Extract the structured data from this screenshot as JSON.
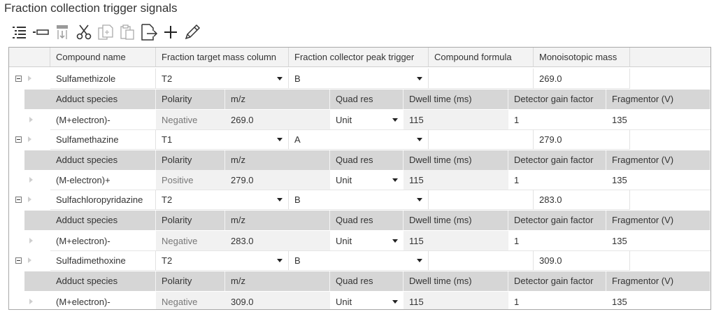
{
  "title": "Fraction collection trigger signals",
  "toolbar": {
    "icons": [
      "list-icon",
      "collapse-icon",
      "insert-below-icon",
      "cut-icon",
      "copy-icon",
      "paste-icon",
      "export-icon",
      "add-icon",
      "edit-icon"
    ]
  },
  "columns": [
    "Compound name",
    "Fraction target mass column",
    "Fraction collector peak trigger",
    "Compound formula",
    "Monoisotopic mass"
  ],
  "child_columns": [
    "Adduct species",
    "Polarity",
    "m/z",
    "Quad res",
    "Dwell time (ms)",
    "Detector gain factor",
    "Fragmentor (V)"
  ],
  "compounds": [
    {
      "name": "Sulfamethizole",
      "target_column": "T2",
      "peak_trigger": "B",
      "formula": "",
      "mass": "269.0",
      "adduct": {
        "species": "(M+electron)-",
        "polarity": "Negative",
        "mz": "269.0",
        "quad_res": "Unit",
        "dwell": "115",
        "gain": "1",
        "fragmentor": "135"
      }
    },
    {
      "name": "Sulfamethazine",
      "target_column": "T1",
      "peak_trigger": "A",
      "formula": "",
      "mass": "279.0",
      "adduct": {
        "species": "(M-electron)+",
        "polarity": "Positive",
        "mz": "279.0",
        "quad_res": "Unit",
        "dwell": "115",
        "gain": "1",
        "fragmentor": "135"
      }
    },
    {
      "name": "Sulfachloropyridazine",
      "target_column": "T2",
      "peak_trigger": "B",
      "formula": "",
      "mass": "283.0",
      "adduct": {
        "species": "(M+electron)-",
        "polarity": "Negative",
        "mz": "283.0",
        "quad_res": "Unit",
        "dwell": "115",
        "gain": "1",
        "fragmentor": "135"
      }
    },
    {
      "name": "Sulfadimethoxine",
      "target_column": "T2",
      "peak_trigger": "B",
      "formula": "",
      "mass": "309.0",
      "adduct": {
        "species": "(M+electron)-",
        "polarity": "Negative",
        "mz": "309.0",
        "quad_res": "Unit",
        "dwell": "115",
        "gain": "1",
        "fragmentor": "135"
      }
    }
  ]
}
